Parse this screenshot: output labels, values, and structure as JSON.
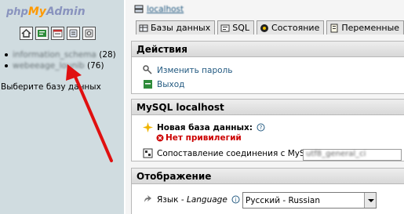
{
  "logo": {
    "php": "php",
    "my": "My",
    "admin": "Admin"
  },
  "quick_icons": [
    "home-icon",
    "sql-query-icon",
    "sql-window-icon",
    "docs-icon",
    "doc-sql-icon"
  ],
  "databases": [
    {
      "name": "information_schema",
      "count": "(28)"
    },
    {
      "name": "webeeage_lounib",
      "count": "(76)"
    }
  ],
  "choose_db": "Выберите базу данных",
  "server": {
    "name": "localhost"
  },
  "tabs": [
    {
      "label": "Базы данных",
      "icon": "databases-icon"
    },
    {
      "label": "SQL",
      "icon": "sql-icon"
    },
    {
      "label": "Состояние",
      "icon": "status-icon"
    },
    {
      "label": "Переменные",
      "icon": "variables-icon"
    }
  ],
  "actions": {
    "title": "Действия",
    "change_password": "Изменить пароль",
    "logout": "Выход"
  },
  "mysql": {
    "title": "MySQL localhost",
    "new_db_label": "Новая база данных:",
    "no_privileges": "Нет привилегий",
    "collation_label": "Сопоставление соединения с MySQL:",
    "collation_value": "utf8_general_ci"
  },
  "display": {
    "title": "Отображение",
    "language_label": "Язык - ",
    "language_label_en": "Language",
    "language_value": "Русский - Russian"
  },
  "colors": {
    "nav_bg": "#d0dce0",
    "link": "#235a81",
    "arrow": "#e01010",
    "logo_accent": "#ff9900"
  }
}
